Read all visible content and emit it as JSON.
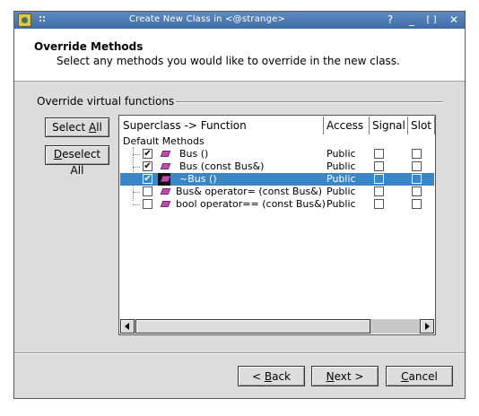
{
  "window": {
    "title": "Create New Class in <@strange>",
    "buttons": {
      "help": "?",
      "minimize": "_",
      "maximize": "[ ]",
      "close": "✕"
    }
  },
  "header": {
    "title": "Override Methods",
    "subtitle": "Select any methods you would like to override in the new class."
  },
  "group": {
    "label": "Override virtual functions"
  },
  "side_buttons": {
    "select_all": {
      "pre": "Select ",
      "mnemonic": "A",
      "post": "ll"
    },
    "deselect_all": {
      "pre": "",
      "mnemonic": "D",
      "post": "eselect All"
    }
  },
  "table": {
    "columns": [
      "Superclass -> Function",
      "Access",
      "Signal",
      "Slot"
    ],
    "group_row": "Default Methods",
    "rows": [
      {
        "function": "Bus ()",
        "access": "Public",
        "checked": true,
        "selected": false
      },
      {
        "function": "Bus (const Bus&)",
        "access": "Public",
        "checked": true,
        "selected": false
      },
      {
        "function": "~Bus ()",
        "access": "Public",
        "checked": true,
        "selected": true
      },
      {
        "function": "Bus& operator= (const Bus&)",
        "access": "Public",
        "checked": false,
        "selected": false
      },
      {
        "function": "bool operator== (const Bus&)",
        "access": "Public",
        "checked": false,
        "selected": false
      }
    ]
  },
  "nav_buttons": {
    "back": {
      "pre": "< ",
      "mnemonic": "B",
      "post": "ack"
    },
    "next": {
      "pre": "",
      "mnemonic": "N",
      "post": "ext >"
    },
    "cancel": {
      "pre": "",
      "mnemonic": "C",
      "post": "ancel"
    }
  },
  "colors": {
    "titlebar": "#4a78b2",
    "selection": "#3a87c8",
    "face": "#dcdcdc"
  }
}
